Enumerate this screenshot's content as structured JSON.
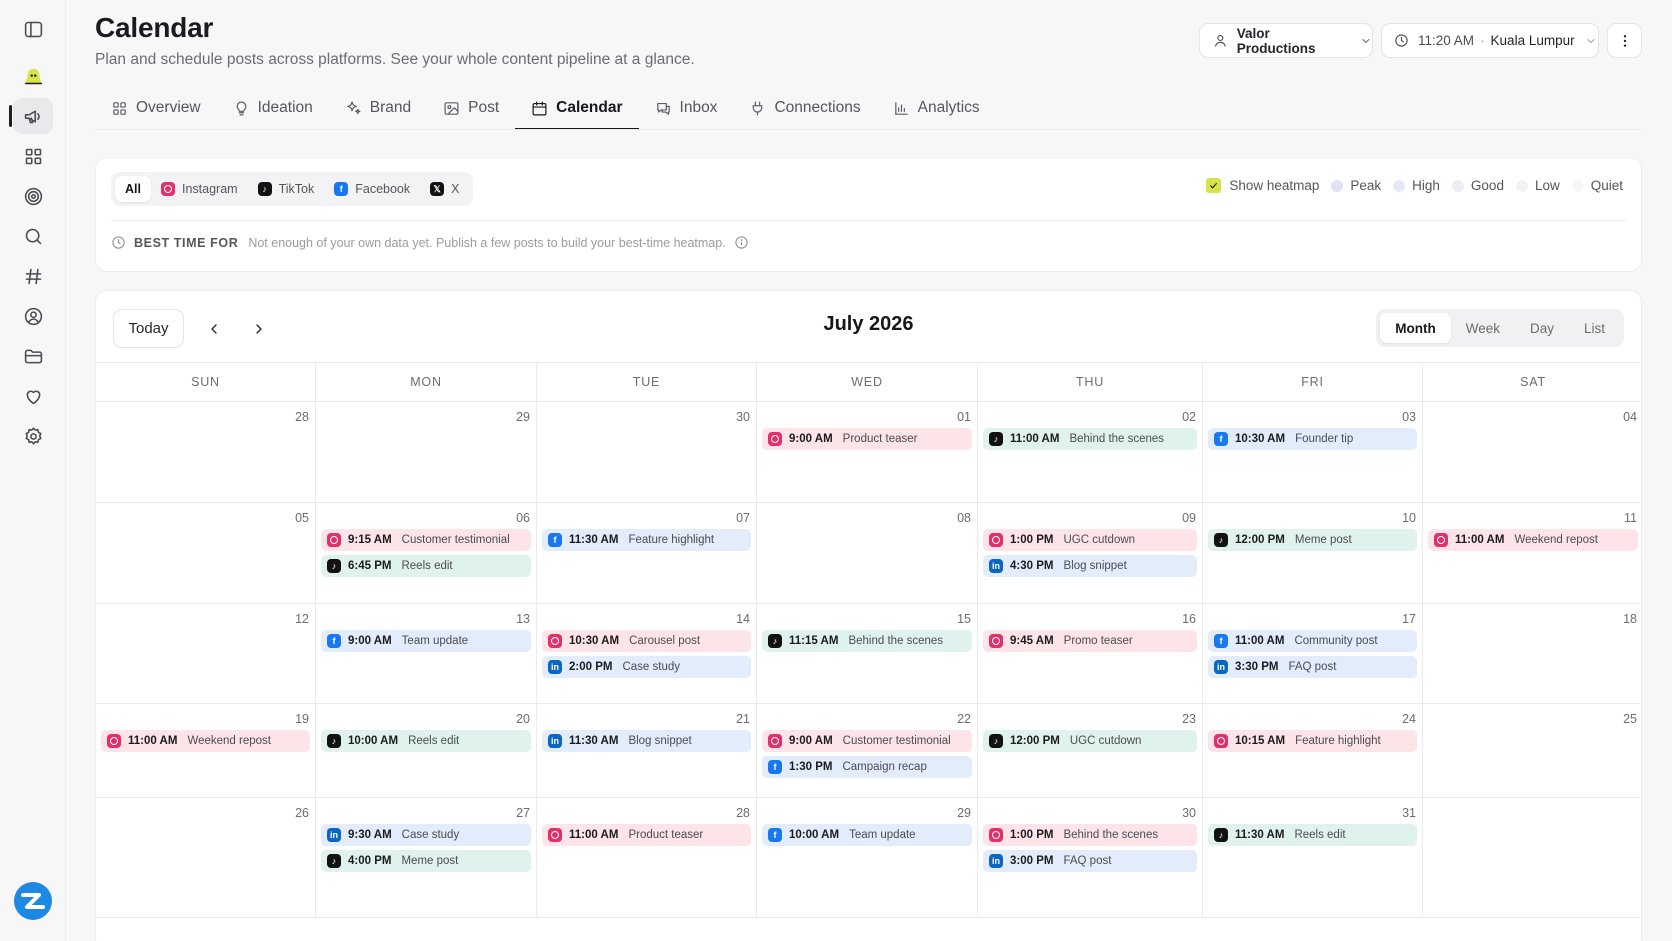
{
  "header": {
    "title": "Calendar",
    "subtitle": "Plan and schedule posts across platforms. See your whole content pipeline at a glance.",
    "workspace": "Valor Productions",
    "time": "11:20 AM",
    "timezone": "Kuala Lumpur",
    "separator": "·"
  },
  "tabs": [
    {
      "label": "Overview",
      "icon": "grid-icon"
    },
    {
      "label": "Ideation",
      "icon": "lightbulb-icon"
    },
    {
      "label": "Brand",
      "icon": "sparkles-icon"
    },
    {
      "label": "Post",
      "icon": "image-icon"
    },
    {
      "label": "Calendar",
      "icon": "calendar-icon",
      "active": true
    },
    {
      "label": "Inbox",
      "icon": "chat-icon"
    },
    {
      "label": "Connections",
      "icon": "plug-icon"
    },
    {
      "label": "Analytics",
      "icon": "bar-chart-icon"
    }
  ],
  "filters": {
    "platforms": [
      {
        "label": "All",
        "icon": null,
        "active": true
      },
      {
        "label": "Instagram",
        "icon": "instagram"
      },
      {
        "label": "TikTok",
        "icon": "tiktok"
      },
      {
        "label": "Facebook",
        "icon": "facebook"
      },
      {
        "label": "X",
        "icon": "x"
      }
    ],
    "show_heatmap_label": "Show heatmap",
    "show_heatmap_checked": true,
    "heatmap_levels": [
      {
        "label": "Peak",
        "color": "#dfe3f6"
      },
      {
        "label": "High",
        "color": "#e5e8f8"
      },
      {
        "label": "Good",
        "color": "#ebedf7"
      },
      {
        "label": "Low",
        "color": "#f1f2f5"
      },
      {
        "label": "Quiet",
        "color": "#f6f6f8"
      }
    ],
    "best_time_label": "BEST TIME FOR",
    "best_time_message": "Not enough of your own data yet. Publish a few posts to build your best-time heatmap."
  },
  "calendar": {
    "today_label": "Today",
    "month_label": "July 2026",
    "views": [
      {
        "label": "Month",
        "active": true
      },
      {
        "label": "Week"
      },
      {
        "label": "Day"
      },
      {
        "label": "List"
      }
    ],
    "weekdays": [
      "SUN",
      "MON",
      "TUE",
      "WED",
      "THU",
      "FRI",
      "SAT"
    ],
    "weeks": [
      [
        {
          "date": "28",
          "events": []
        },
        {
          "date": "29",
          "events": []
        },
        {
          "date": "30",
          "events": []
        },
        {
          "date": "01",
          "events": [
            {
              "platform": "instagram",
              "time": "9:00 AM",
              "title": "Product teaser"
            }
          ]
        },
        {
          "date": "02",
          "events": [
            {
              "platform": "tiktok",
              "time": "11:00 AM",
              "title": "Behind the scenes"
            }
          ]
        },
        {
          "date": "03",
          "events": [
            {
              "platform": "facebook",
              "time": "10:30 AM",
              "title": "Founder tip"
            }
          ]
        },
        {
          "date": "04",
          "events": []
        }
      ],
      [
        {
          "date": "05",
          "events": []
        },
        {
          "date": "06",
          "events": [
            {
              "platform": "instagram",
              "time": "9:15 AM",
              "title": "Customer testimonial"
            },
            {
              "platform": "tiktok",
              "time": "6:45 PM",
              "title": "Reels edit"
            }
          ]
        },
        {
          "date": "07",
          "events": [
            {
              "platform": "facebook",
              "time": "11:30 AM",
              "title": "Feature highlight"
            }
          ]
        },
        {
          "date": "08",
          "events": []
        },
        {
          "date": "09",
          "events": [
            {
              "platform": "instagram",
              "time": "1:00 PM",
              "title": "UGC cutdown"
            },
            {
              "platform": "linkedin",
              "time": "4:30 PM",
              "title": "Blog snippet"
            }
          ]
        },
        {
          "date": "10",
          "events": [
            {
              "platform": "tiktok",
              "time": "12:00 PM",
              "title": "Meme post"
            }
          ]
        },
        {
          "date": "11",
          "events": [
            {
              "platform": "instagram",
              "time": "11:00 AM",
              "title": "Weekend repost"
            }
          ]
        }
      ],
      [
        {
          "date": "12",
          "events": []
        },
        {
          "date": "13",
          "events": [
            {
              "platform": "facebook",
              "time": "9:00 AM",
              "title": "Team update"
            }
          ]
        },
        {
          "date": "14",
          "events": [
            {
              "platform": "instagram",
              "time": "10:30 AM",
              "title": "Carousel post"
            },
            {
              "platform": "linkedin",
              "time": "2:00 PM",
              "title": "Case study"
            }
          ]
        },
        {
          "date": "15",
          "events": [
            {
              "platform": "tiktok",
              "time": "11:15 AM",
              "title": "Behind the scenes"
            }
          ]
        },
        {
          "date": "16",
          "events": [
            {
              "platform": "instagram",
              "time": "9:45 AM",
              "title": "Promo teaser"
            }
          ]
        },
        {
          "date": "17",
          "events": [
            {
              "platform": "facebook",
              "time": "11:00 AM",
              "title": "Community post"
            },
            {
              "platform": "linkedin",
              "time": "3:30 PM",
              "title": "FAQ post"
            }
          ]
        },
        {
          "date": "18",
          "events": []
        }
      ],
      [
        {
          "date": "19",
          "events": [
            {
              "platform": "instagram",
              "time": "11:00 AM",
              "title": "Weekend repost"
            }
          ]
        },
        {
          "date": "20",
          "events": [
            {
              "platform": "tiktok",
              "time": "10:00 AM",
              "title": "Reels edit"
            }
          ]
        },
        {
          "date": "21",
          "events": [
            {
              "platform": "linkedin",
              "time": "11:30 AM",
              "title": "Blog snippet"
            }
          ]
        },
        {
          "date": "22",
          "events": [
            {
              "platform": "instagram",
              "time": "9:00 AM",
              "title": "Customer testimonial"
            },
            {
              "platform": "facebook",
              "time": "1:30 PM",
              "title": "Campaign recap"
            }
          ]
        },
        {
          "date": "23",
          "events": [
            {
              "platform": "tiktok",
              "time": "12:00 PM",
              "title": "UGC cutdown"
            }
          ]
        },
        {
          "date": "24",
          "events": [
            {
              "platform": "instagram",
              "time": "10:15 AM",
              "title": "Feature highlight"
            }
          ]
        },
        {
          "date": "25",
          "events": []
        }
      ],
      [
        {
          "date": "26",
          "events": []
        },
        {
          "date": "27",
          "events": [
            {
              "platform": "linkedin",
              "time": "9:30 AM",
              "title": "Case study"
            },
            {
              "platform": "tiktok",
              "time": "4:00 PM",
              "title": "Meme post"
            }
          ]
        },
        {
          "date": "28",
          "events": [
            {
              "platform": "instagram",
              "time": "11:00 AM",
              "title": "Product teaser"
            }
          ]
        },
        {
          "date": "29",
          "events": [
            {
              "platform": "facebook",
              "time": "10:00 AM",
              "title": "Team update"
            }
          ]
        },
        {
          "date": "30",
          "events": [
            {
              "platform": "instagram",
              "time": "1:00 PM",
              "title": "Behind the scenes"
            },
            {
              "platform": "linkedin",
              "time": "3:00 PM",
              "title": "FAQ post"
            }
          ]
        },
        {
          "date": "31",
          "events": [
            {
              "platform": "tiktok",
              "time": "11:30 AM",
              "title": "Reels edit"
            }
          ]
        },
        {
          "date": "",
          "events": []
        }
      ]
    ]
  }
}
